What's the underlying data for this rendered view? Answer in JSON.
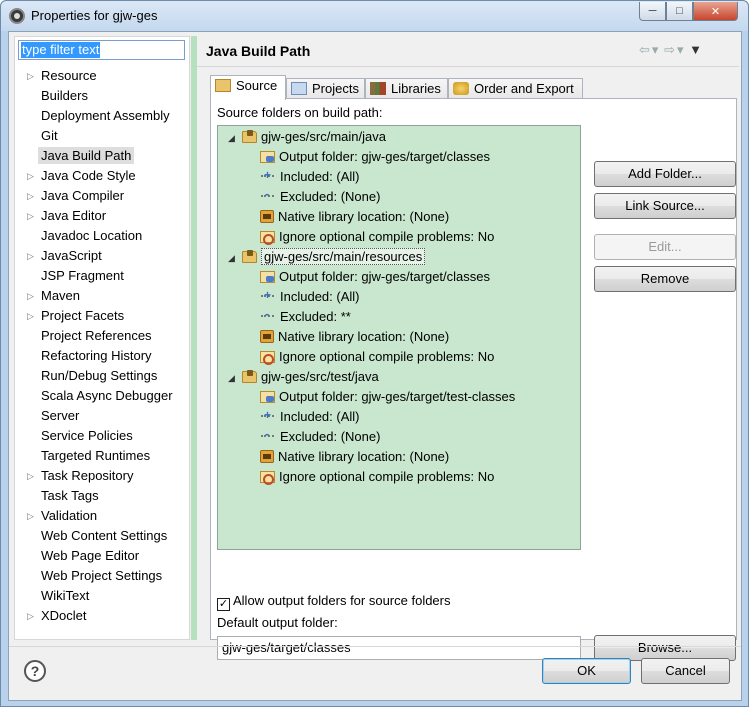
{
  "window": {
    "title": "Properties for gjw-ges"
  },
  "filter": {
    "value": "type filter text"
  },
  "tree_items": [
    {
      "label": "Resource",
      "expandable": true
    },
    {
      "label": "Builders",
      "expandable": false
    },
    {
      "label": "Deployment Assembly",
      "expandable": false
    },
    {
      "label": "Git",
      "expandable": false
    },
    {
      "label": "Java Build Path",
      "expandable": false,
      "selected": true
    },
    {
      "label": "Java Code Style",
      "expandable": true
    },
    {
      "label": "Java Compiler",
      "expandable": true
    },
    {
      "label": "Java Editor",
      "expandable": true
    },
    {
      "label": "Javadoc Location",
      "expandable": false
    },
    {
      "label": "JavaScript",
      "expandable": true
    },
    {
      "label": "JSP Fragment",
      "expandable": false
    },
    {
      "label": "Maven",
      "expandable": true
    },
    {
      "label": "Project Facets",
      "expandable": true
    },
    {
      "label": "Project References",
      "expandable": false
    },
    {
      "label": "Refactoring History",
      "expandable": false
    },
    {
      "label": "Run/Debug Settings",
      "expandable": false
    },
    {
      "label": "Scala Async Debugger",
      "expandable": false
    },
    {
      "label": "Server",
      "expandable": false
    },
    {
      "label": "Service Policies",
      "expandable": false
    },
    {
      "label": "Targeted Runtimes",
      "expandable": false
    },
    {
      "label": "Task Repository",
      "expandable": true
    },
    {
      "label": "Task Tags",
      "expandable": false
    },
    {
      "label": "Validation",
      "expandable": true
    },
    {
      "label": "Web Content Settings",
      "expandable": false
    },
    {
      "label": "Web Page Editor",
      "expandable": false
    },
    {
      "label": "Web Project Settings",
      "expandable": false
    },
    {
      "label": "WikiText",
      "expandable": false
    },
    {
      "label": "XDoclet",
      "expandable": true
    }
  ],
  "page": {
    "title": "Java Build Path"
  },
  "tabs": [
    {
      "label": "Source",
      "icon": "source-folder-icon",
      "active": true
    },
    {
      "label": "Projects",
      "icon": "projects-icon",
      "active": false
    },
    {
      "label": "Libraries",
      "icon": "libraries-icon",
      "active": false
    },
    {
      "label": "Order and Export",
      "icon": "order-export-icon",
      "active": false
    }
  ],
  "source": {
    "label": "Source folders on build path:",
    "folders": [
      {
        "name": "gjw-ges/src/main/java",
        "children": [
          {
            "icon": "out",
            "text": "Output folder: gjw-ges/target/classes"
          },
          {
            "icon": "inc",
            "text": "Included: (All)"
          },
          {
            "icon": "exc",
            "text": "Excluded: (None)"
          },
          {
            "icon": "nat",
            "text": "Native library location: (None)"
          },
          {
            "icon": "ign",
            "text": "Ignore optional compile problems: No"
          }
        ]
      },
      {
        "name": "gjw-ges/src/main/resources",
        "selected": true,
        "children": [
          {
            "icon": "out",
            "text": "Output folder: gjw-ges/target/classes"
          },
          {
            "icon": "inc",
            "text": "Included: (All)"
          },
          {
            "icon": "exc",
            "text": "Excluded: **"
          },
          {
            "icon": "nat",
            "text": "Native library location: (None)"
          },
          {
            "icon": "ign",
            "text": "Ignore optional compile problems: No"
          }
        ]
      },
      {
        "name": "gjw-ges/src/test/java",
        "children": [
          {
            "icon": "out",
            "text": "Output folder: gjw-ges/target/test-classes"
          },
          {
            "icon": "inc",
            "text": "Included: (All)"
          },
          {
            "icon": "exc",
            "text": "Excluded: (None)"
          },
          {
            "icon": "nat",
            "text": "Native library location: (None)"
          },
          {
            "icon": "ign",
            "text": "Ignore optional compile problems: No"
          }
        ]
      }
    ]
  },
  "buttons": {
    "add_folder": "Add Folder...",
    "link_source": "Link Source...",
    "edit": "Edit...",
    "remove": "Remove",
    "browse": "Browse...",
    "ok": "OK",
    "cancel": "Cancel"
  },
  "allow_output": {
    "label": "Allow output folders for source folders",
    "checked": true
  },
  "default_output": {
    "label": "Default output folder:",
    "value": "gjw-ges/target/classes"
  },
  "help": {
    "glyph": "?"
  },
  "colors": {
    "tree_background": "#c9e6cf",
    "sash": "#b6e0bf",
    "selection": "#3399ff"
  }
}
